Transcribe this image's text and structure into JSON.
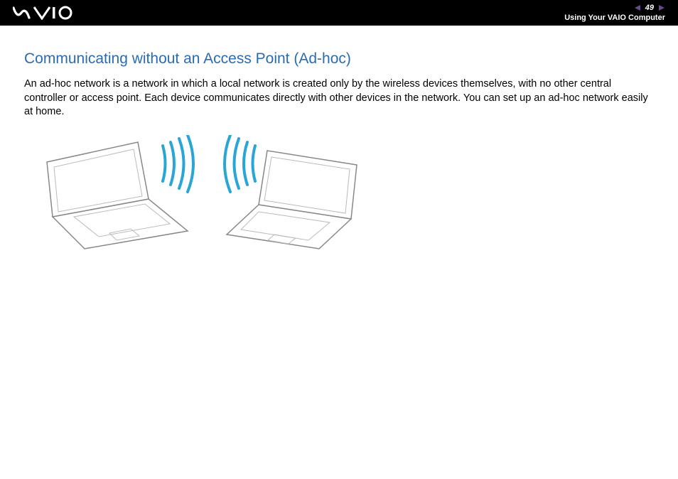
{
  "header": {
    "page_number": "49",
    "section_label": "Using Your VAIO Computer"
  },
  "content": {
    "heading": "Communicating without an Access Point (Ad-hoc)",
    "paragraph": "An ad-hoc network is a network in which a local network is created only by the wireless devices themselves, with no other central controller or access point. Each device communicates directly with other devices in the network. You can set up an ad-hoc network easily at home."
  }
}
